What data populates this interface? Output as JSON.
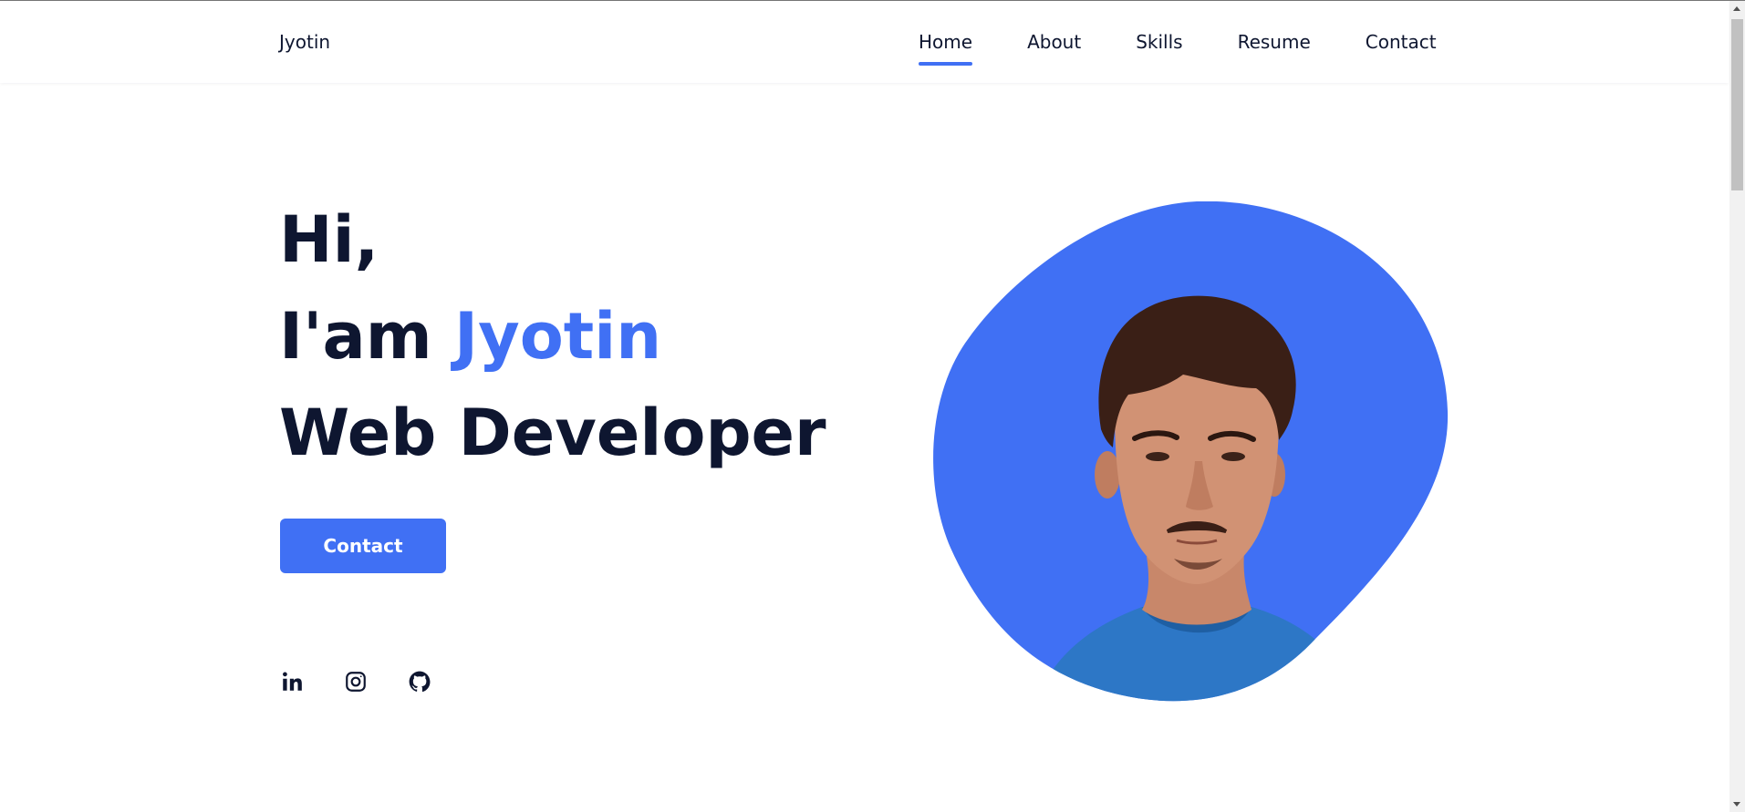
{
  "header": {
    "logo": "Jyotin",
    "nav": [
      {
        "label": "Home",
        "active": true
      },
      {
        "label": "About"
      },
      {
        "label": "Skills"
      },
      {
        "label": "Resume"
      },
      {
        "label": "Contact"
      }
    ]
  },
  "hero": {
    "line1": "Hi,",
    "line2_prefix": "I'am ",
    "line2_name": "Jyotin",
    "line3": "Web Developer",
    "cta_label": "Contact"
  },
  "socials": [
    {
      "icon": "linkedin-icon"
    },
    {
      "icon": "instagram-icon"
    },
    {
      "icon": "github-icon"
    }
  ],
  "colors": {
    "accent": "#4070f4",
    "text": "#0e1630"
  }
}
